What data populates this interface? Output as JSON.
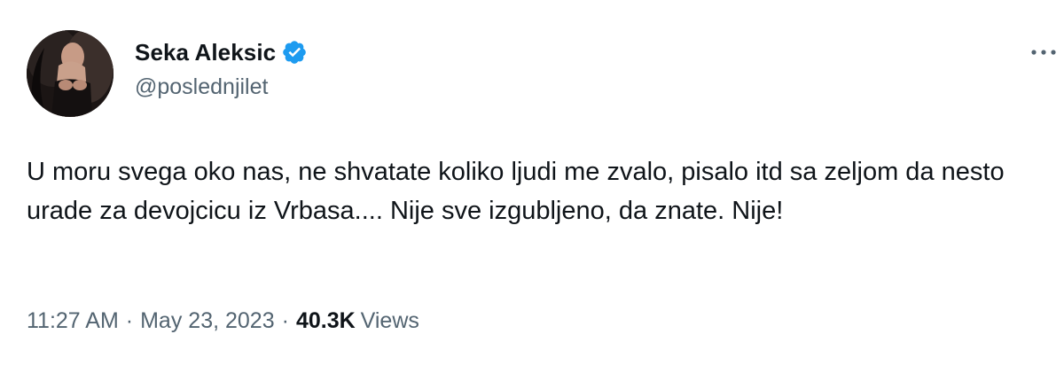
{
  "author": {
    "display_name": "Seka Aleksic",
    "handle": "@poslednjilet",
    "verified_icon": "verified-badge-icon",
    "verified_color": "#1d9bf0"
  },
  "tweet": {
    "text": "U moru svega oko nas, ne shvatate koliko ljudi me zvalo, pisalo itd sa zeljom da nesto urade za devojcicu iz Vrbasa.... Nije sve izgubljeno, da znate. Nije!"
  },
  "meta": {
    "time": "11:27 AM",
    "separator": "·",
    "date": "May 23, 2023",
    "views_count": "40.3K",
    "views_label": "Views"
  },
  "menu": {
    "icon": "more-horizontal-icon"
  },
  "colors": {
    "text_primary": "#0f1419",
    "text_secondary": "#536471",
    "background": "#ffffff"
  }
}
